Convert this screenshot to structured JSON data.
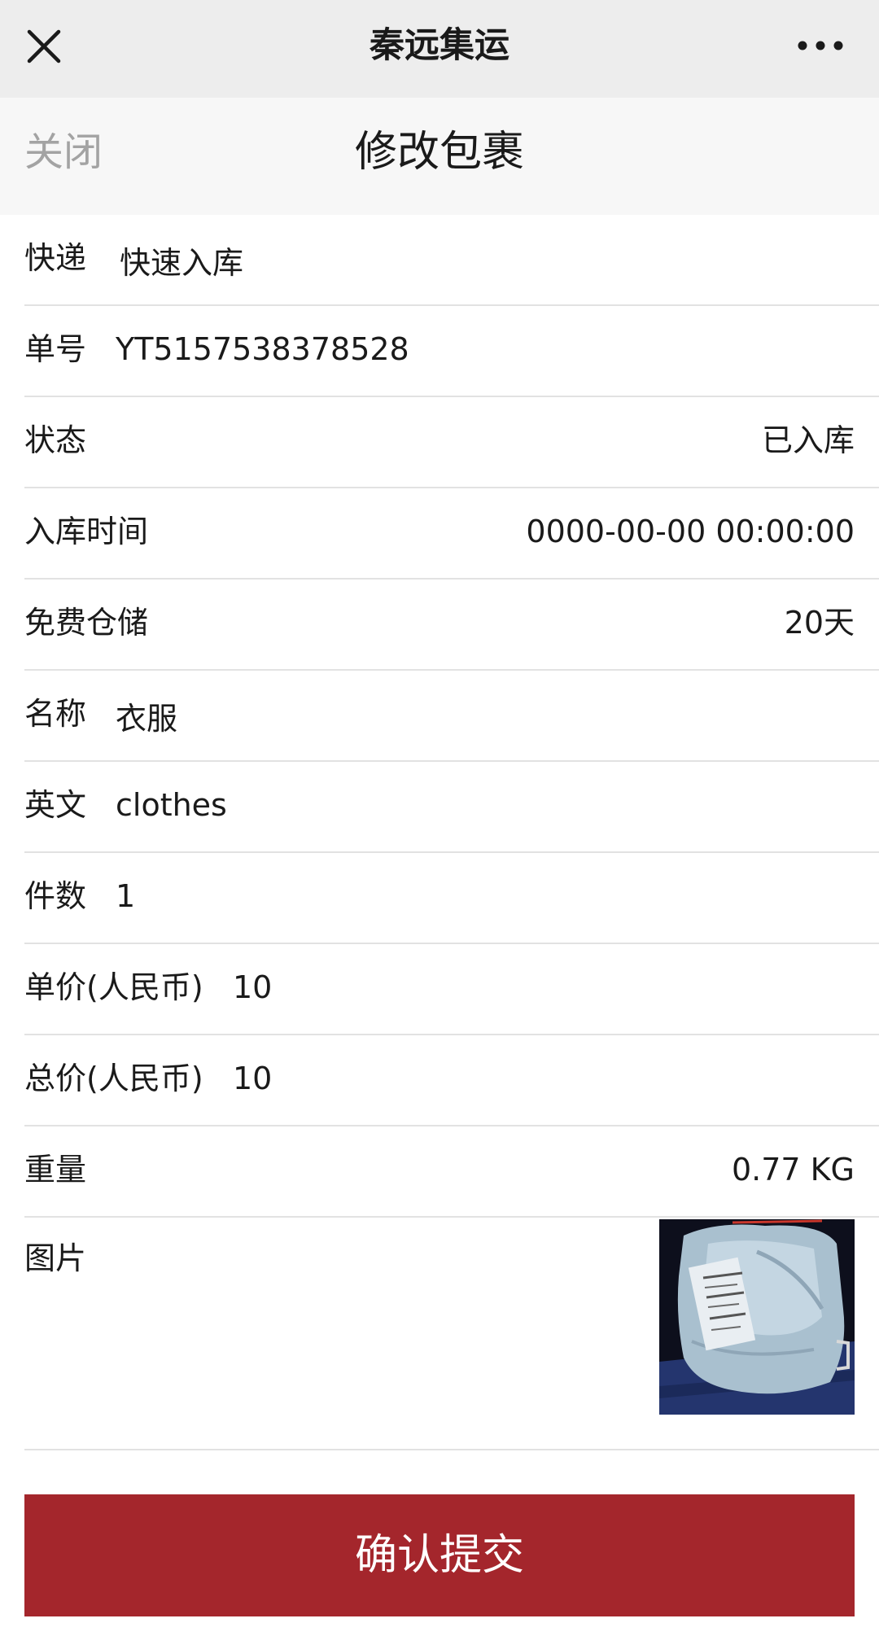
{
  "wechat_bar": {
    "title": "秦远集运",
    "close_icon": "close-icon",
    "more_icon": "more-icon"
  },
  "page_header": {
    "close_label": "关闭",
    "title": "修改包裹"
  },
  "fields": {
    "courier": {
      "label": "快递",
      "value": "快速入库"
    },
    "tracking_no": {
      "label": "单号",
      "value": "YT5157538378528"
    },
    "status": {
      "label": "状态",
      "value": "已入库"
    },
    "inbound_time": {
      "label": "入库时间",
      "value": "0000-00-00 00:00:00"
    },
    "free_storage": {
      "label": "免费仓储",
      "value": "20天"
    },
    "name": {
      "label": "名称",
      "value": "衣服"
    },
    "english": {
      "label": "英文",
      "value": "clothes"
    },
    "quantity": {
      "label": "件数",
      "value": "1"
    },
    "unit_price": {
      "label": "单价(人民币)",
      "value": "10"
    },
    "total_price": {
      "label": "总价(人民币)",
      "value": "10"
    },
    "weight": {
      "label": "重量",
      "value": "0.77 KG"
    },
    "picture": {
      "label": "图片"
    }
  },
  "submit_label": "确认提交",
  "colors": {
    "submit_background": "#a4262c",
    "top_bar": "#ededed",
    "header_background": "#f7f7f7",
    "close_text": "#a3a3a3",
    "divider": "#e2e2e2"
  }
}
